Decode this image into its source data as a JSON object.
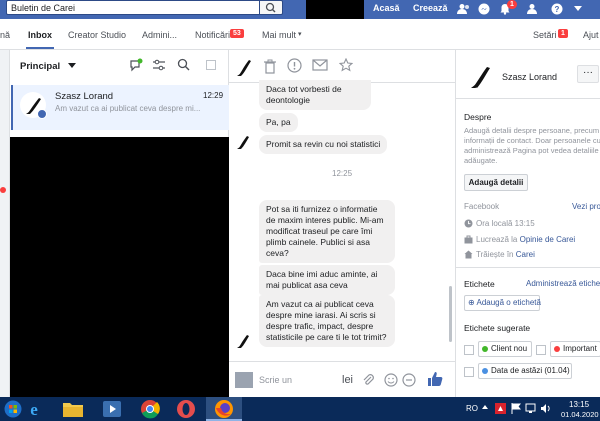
{
  "topbar": {
    "search_value": "Buletin de Carei",
    "home_label": "Acasă",
    "create_label": "Creează",
    "notifications_count": "1"
  },
  "nav": {
    "partial_left": "nă",
    "inbox": "Inbox",
    "creator_studio": "Creator Studio",
    "admin": "Admini...",
    "notifications": "Notificări",
    "notifications_badge": "53",
    "more": "Mai mult",
    "settings": "Setări",
    "settings_badge": "1",
    "help_partial": "Ajut"
  },
  "inbox": {
    "filter": "Principal",
    "conversation": {
      "name": "Szasz Lorand",
      "time": "12:29",
      "preview": "Am vazut ca ai publicat ceva despre mi..."
    }
  },
  "chat": {
    "messages": [
      "Daca tot vorbesti de deontologie",
      "Pa, pa",
      "Promit sa revin cu noi statistici",
      "Pot sa iti furnizez o informatie de maxim interes public. Mi-am modificat traseul pe care îmi plimb cainele. Publici si asa ceva?",
      "Daca bine imi aduc aminte, ai mai publicat asa ceva",
      "Am vazut ca ai publicat ceva despre mine iarasi. Ai scris si despre trafic, impact, despre statisticile pe care ti le tot trimit?"
    ],
    "timestamp": "12:25",
    "composer_placeholder": "Scrie un",
    "composer_lei": "lei"
  },
  "details": {
    "name": "Szasz Lorand",
    "about_title": "Despre",
    "about_text": "Adaugă detalii despre persoane, precum informații de contact. Doar persoanele cu administrează Pagina pot vedea detaliile adăugate.",
    "add_details_btn": "Adaugă detalii",
    "facebook_label": "Facebook",
    "view_profile": "Vezi profil",
    "local_time": "Ora locală 13:15",
    "works_prefix": "Lucrează la",
    "works_at": "Opinie de Carei",
    "lives_prefix": "Trăiește în",
    "lives_in": "Carei",
    "labels_title": "Etichete",
    "manage_labels": "Administrează etichete",
    "add_label": "Adaugă o etichetă",
    "suggested_title": "Etichete sugerate",
    "tag_client": "Client nou",
    "tag_important": "Important",
    "tag_today": "Data de astăzi (01.04)"
  },
  "taskbar": {
    "lang": "RO",
    "time": "13:15",
    "date": "01.04.2020"
  },
  "colors": {
    "fb_blue": "#4267b2",
    "link": "#385898",
    "badge_red": "#fa3e3e",
    "taskbar": "#0a2a59"
  }
}
